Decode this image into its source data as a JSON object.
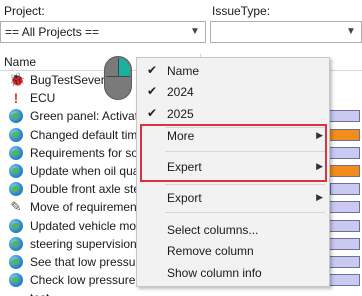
{
  "filters": {
    "project_label": "Project:",
    "project_value": "== All Projects ==",
    "issuetype_label": "IssueType:",
    "issuetype_value": ""
  },
  "grid": {
    "name_header": "Name",
    "rows": [
      {
        "icon": "bug-icon",
        "text": "BugTestSeverity",
        "bar": {
          "orange": 0.0,
          "blue_start": 0.0,
          "blue": 0.0
        }
      },
      {
        "icon": "exclamation-icon",
        "text": "ECU",
        "bar": {
          "orange": 0.0,
          "blue_start": 0.0,
          "blue": 0.0
        }
      },
      {
        "icon": "globe-icon",
        "text": "Green panel: Activation",
        "bar": {
          "orange": 0.0,
          "blue_start": 0.0,
          "blue": 0.0
        }
      },
      {
        "icon": "globe-icon",
        "text": "Changed default time",
        "bar": {
          "orange": 1.0,
          "blue_start": 0.0,
          "blue": 0.0
        }
      },
      {
        "icon": "globe-icon",
        "text": "Requirements for so",
        "bar": {
          "orange": 0.0,
          "blue_start": 0.0,
          "blue": 0.0
        }
      },
      {
        "icon": "globe-icon",
        "text": "Update when oil qua",
        "bar": {
          "orange": 1.0,
          "blue_start": 0.0,
          "blue": 0.0
        }
      },
      {
        "icon": "globe-icon",
        "text": "Double front axle ste",
        "bar": {
          "orange": 0.15,
          "blue_start": 0.15,
          "blue": 0.1
        }
      },
      {
        "icon": "pen-icon",
        "text": "Move of requirement",
        "bar": {
          "orange": 0.0,
          "blue_start": 0.0,
          "blue": 0.0
        }
      },
      {
        "icon": "globe-icon",
        "text": "Updated vehicle mod",
        "bar": {
          "orange": 0.0,
          "blue_start": 0.0,
          "blue": 0.0
        }
      },
      {
        "icon": "globe-icon",
        "text": "steering supervision",
        "bar": {
          "orange": 0.0,
          "blue_start": 0.0,
          "blue": 0.0
        }
      },
      {
        "icon": "globe-icon",
        "text": "See that low pressur",
        "bar": {
          "orange": 0.1,
          "blue_start": 0.1,
          "blue": 0.1
        }
      },
      {
        "icon": "globe-icon",
        "text": "Check low pressure v",
        "bar": {
          "orange": 0.0,
          "blue_start": 0.0,
          "blue": 0.0
        }
      },
      {
        "icon": "",
        "text": "test",
        "bar": null
      }
    ]
  },
  "context_menu": {
    "items": [
      {
        "label": "Name",
        "checked": true,
        "submenu": false
      },
      {
        "label": "2024",
        "checked": true,
        "submenu": false
      },
      {
        "label": "2025",
        "checked": true,
        "submenu": false
      },
      {
        "label": "More",
        "checked": false,
        "submenu": true
      },
      {
        "label": "Expert",
        "checked": false,
        "submenu": true
      },
      {
        "label": "Export",
        "checked": false,
        "submenu": true
      },
      {
        "label": "Select columns...",
        "checked": false,
        "submenu": false
      },
      {
        "label": "Remove column",
        "checked": false,
        "submenu": false
      },
      {
        "label": "Show column info",
        "checked": false,
        "submenu": false
      }
    ]
  },
  "colors": {
    "highlight_border": "#d9343c",
    "bar_fill": "#c9c9f2",
    "bar_orange": "#f28c1a",
    "bar_blue": "#4a68d8"
  }
}
